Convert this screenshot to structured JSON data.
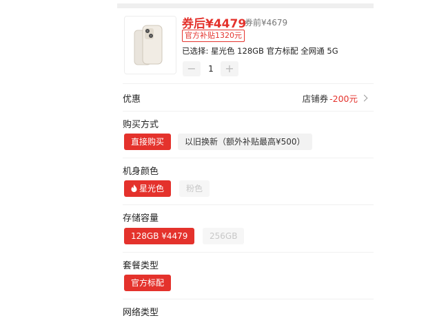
{
  "product": {
    "price_after_coupon": "券后¥4479",
    "price_before_coupon": "券前¥4679",
    "subsidy_badge": "官方补贴1320元",
    "selected_summary": "已选择: 星光色 128GB 官方标配 全网通 5G",
    "quantity": "1",
    "minus_symbol": "−",
    "plus_symbol": "+",
    "image_icon": "iphone-starlight-image"
  },
  "discount": {
    "label": "优惠",
    "coupon_text": "店铺券",
    "coupon_amount": "-200元"
  },
  "purchase_method": {
    "label": "购买方式",
    "options": [
      "直接购买",
      "以旧换新（额外补贴最高¥500）"
    ]
  },
  "color": {
    "label": "机身颜色",
    "options": [
      "星光色",
      "粉色"
    ]
  },
  "storage": {
    "label": "存储容量",
    "options": [
      "128GB ¥4479",
      "256GB"
    ]
  },
  "package": {
    "label": "套餐类型",
    "options": [
      "官方标配"
    ]
  },
  "network": {
    "label": "网络类型"
  },
  "colors": {
    "accent": "#e4322c",
    "option_bg": "#f2f2f2",
    "disabled_text": "#c8c8c8"
  }
}
